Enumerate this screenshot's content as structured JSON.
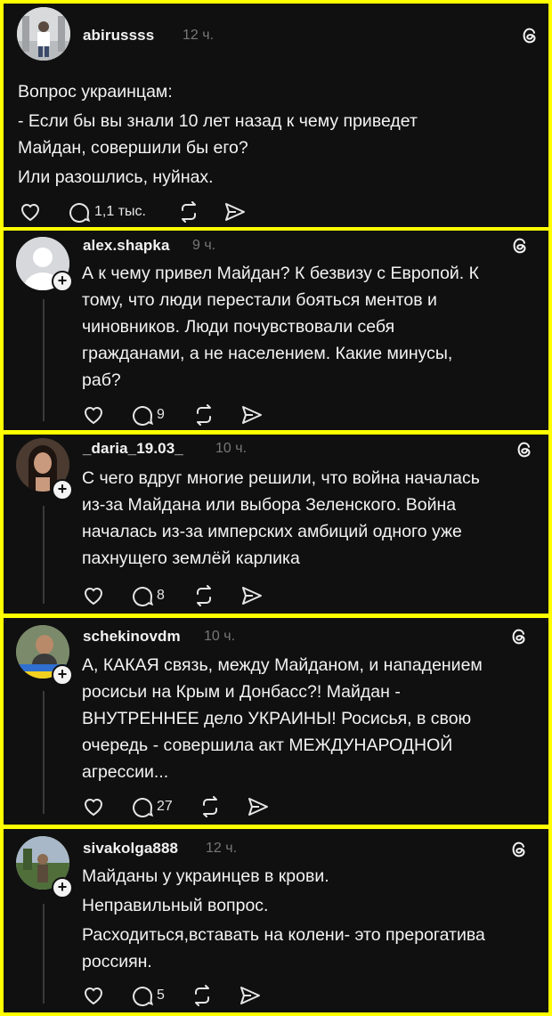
{
  "colors": {
    "background": "#ffff00",
    "card": "#101010",
    "text": "#f3f3f3",
    "muted": "#777777"
  },
  "posts": [
    {
      "username": "abirussss",
      "time": "12 ч.",
      "lines": [
        "Вопрос украинцам:",
        "- Если бы вы знали 10 лет назад к чему приведет",
        "Майдан, совершили бы его?",
        "Или разошлись, нуйнах."
      ],
      "reply_count": "1,1 тыс."
    },
    {
      "username": "alex.shapka",
      "time": "9 ч.",
      "lines": [
        "А к чему привел Майдан? К безвизу с Европой. К",
        "тому, что люди перестали бояться ментов и",
        "чиновников. Люди почувствовали себя",
        "гражданами, а не населением. Какие минусы,",
        "раб?"
      ],
      "reply_count": "9"
    },
    {
      "username": "_daria_19.03_",
      "time": "10 ч.",
      "lines": [
        "С чего вдруг многие решили, что война началась",
        "из-за Майдана или выбора Зеленского. Война",
        "началась из-за имперских амбиций одного уже",
        "пахнущего землёй карлика"
      ],
      "reply_count": "8"
    },
    {
      "username": "schekinovdm",
      "time": "10 ч.",
      "lines": [
        "А, КАКАЯ связь, между Майданом, и нападением",
        "росисьи на Крым и Донбасс?! Майдан -",
        "ВНУТРЕННЕЕ дело УКРАИНЫ! Росисья, в свою",
        "очередь - совершила акт МЕЖДУНАРОДНОЙ",
        "агрессии..."
      ],
      "reply_count": "27"
    },
    {
      "username": "sivakolga888",
      "time": "12 ч.",
      "lines": [
        "Майданы у украинцев в крови.",
        "Неправильный вопрос.",
        "Расходиться,вставать на колени- это прерогатива",
        "россиян."
      ],
      "reply_count": "5"
    }
  ]
}
